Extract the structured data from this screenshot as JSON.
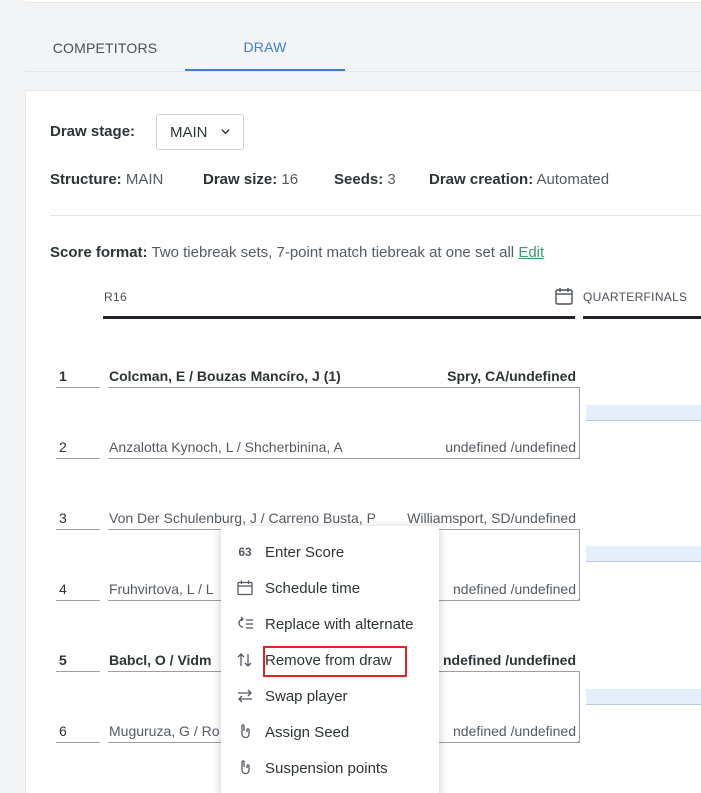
{
  "tabs": [
    {
      "label": "COMPETITORS"
    },
    {
      "label": "DRAW"
    }
  ],
  "draw_stage": {
    "label": "Draw stage:",
    "value": "MAIN"
  },
  "info": {
    "structure_label": "Structure:",
    "structure_value": "MAIN",
    "size_label": "Draw size:",
    "size_value": "16",
    "seeds_label": "Seeds:",
    "seeds_value": "3",
    "creation_label": "Draw creation:",
    "creation_value": "Automated"
  },
  "score_format": {
    "label": "Score format:",
    "value": "Two tiebreak sets, 7-point match tiebreak at one set all",
    "edit": "Edit"
  },
  "rounds": [
    "R16",
    "QUARTERFINALS"
  ],
  "slots": [
    {
      "num": "1",
      "name": "Colcman, E / Bouzas Mancíro, J (1)",
      "club": "Spry, CA/undefined",
      "bold": true
    },
    {
      "num": "2",
      "name": "Anzalotta Kynoch, L / Shcherbinina, A",
      "club": "undefined /undefined",
      "bold": false
    },
    {
      "num": "3",
      "name": "Von Der Schulenburg, J / Carreno Busta, P",
      "club": "Williamsport, SD/undefined",
      "bold": false
    },
    {
      "num": "4",
      "name": "Fruhvirtova, L / L",
      "club": "ndefined /undefined",
      "bold": false
    },
    {
      "num": "5",
      "name": "Babcl, O / Vidm",
      "club": "ndefined /undefined",
      "bold": true
    },
    {
      "num": "6",
      "name": "Muguruza, G / Ro",
      "club": "ndefined /undefined",
      "bold": false
    }
  ],
  "context_menu": {
    "items": [
      {
        "label": "Enter Score",
        "icon": "score-icon",
        "glyph": "63"
      },
      {
        "label": "Schedule time",
        "icon": "calendar-icon",
        "glyph": ""
      },
      {
        "label": "Replace with alternate",
        "icon": "replace-icon",
        "glyph": ""
      },
      {
        "label": "Remove from draw",
        "icon": "remove-icon",
        "glyph": ""
      },
      {
        "label": "Swap player",
        "icon": "swap-icon",
        "glyph": ""
      },
      {
        "label": "Assign Seed",
        "icon": "seed-icon",
        "glyph": ""
      },
      {
        "label": "Suspension points",
        "icon": "suspension-icon",
        "glyph": ""
      }
    ]
  },
  "colors": {
    "accent": "#3d7fcb",
    "highlight": "#e02424",
    "edit_link": "#3d9a6b"
  }
}
